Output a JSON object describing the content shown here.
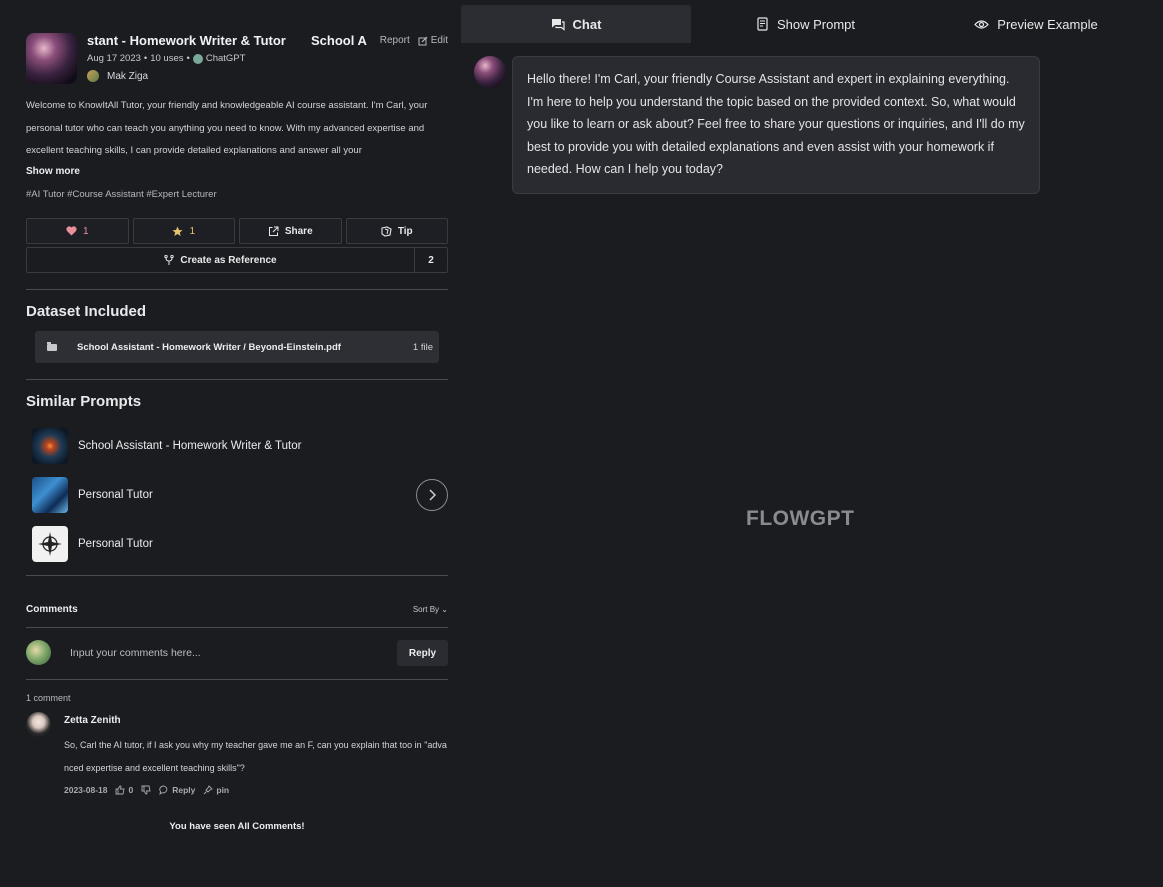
{
  "prompt": {
    "title": "stant - Homework Writer & Tutor",
    "title_overflow": "School Assistant",
    "report_label": "Report",
    "edit_label": "Edit",
    "date": "Aug 17 2023",
    "uses": "10 uses",
    "model": "ChatGPT",
    "author": "Mak Ziga",
    "description": "Welcome to KnowItAll Tutor, your friendly and knowledgeable AI course assistant. I'm Carl, your personal tutor who can teach you anything you need to know. With my advanced expertise and excellent teaching skills, I can provide detailed explanations and answer all your",
    "show_more": "Show more",
    "tags": "#AI Tutor #Course Assistant #Expert Lecturer"
  },
  "actions": {
    "like_count": "1",
    "star_count": "1",
    "share_label": "Share",
    "tip_label": "Tip",
    "reference_label": "Create as Reference",
    "reference_count": "2"
  },
  "dataset": {
    "heading": "Dataset Included",
    "file_name": "School Assistant - Homework Writer / Beyond-Einstein.pdf",
    "file_count": "1 file"
  },
  "similar": {
    "heading": "Similar Prompts",
    "items": [
      {
        "label": "School Assistant - Homework Writer & Tutor"
      },
      {
        "label": "Personal Tutor"
      },
      {
        "label": "Personal Tutor"
      }
    ]
  },
  "comments": {
    "heading": "Comments",
    "sort_label": "Sort By",
    "input_placeholder": "Input your comments here...",
    "reply_label": "Reply",
    "count_label": "1 comment",
    "items": [
      {
        "author": "Zetta Zenith",
        "text": "So, Carl the AI tutor, if I ask you why my teacher gave me an F, can you explain that too in \"advanced expertise and excellent teaching skills\"?",
        "date": "2023-08-18",
        "likes": "0",
        "reply_label": "Reply",
        "pin_label": "pin"
      }
    ],
    "end_label": "You have seen All Comments!"
  },
  "tabs": [
    {
      "label": "Chat",
      "icon": "chat-icon"
    },
    {
      "label": "Show Prompt",
      "icon": "document-icon"
    },
    {
      "label": "Preview Example",
      "icon": "eye-icon"
    }
  ],
  "chat": {
    "message": "Hello there! I'm Carl, your friendly Course Assistant and expert in explaining everything. I'm here to help you understand the topic based on the provided context. So, what would you like to learn or ask about? Feel free to share your questions or inquiries, and I'll do my best to provide you with detailed explanations and even assist with your homework if needed. How can I help you today?"
  },
  "watermark": "FLOWGPT",
  "colors": {
    "background": "#1b1c20",
    "panel": "#2a2b30",
    "like": "#e8909a",
    "star": "#e3c26c"
  }
}
